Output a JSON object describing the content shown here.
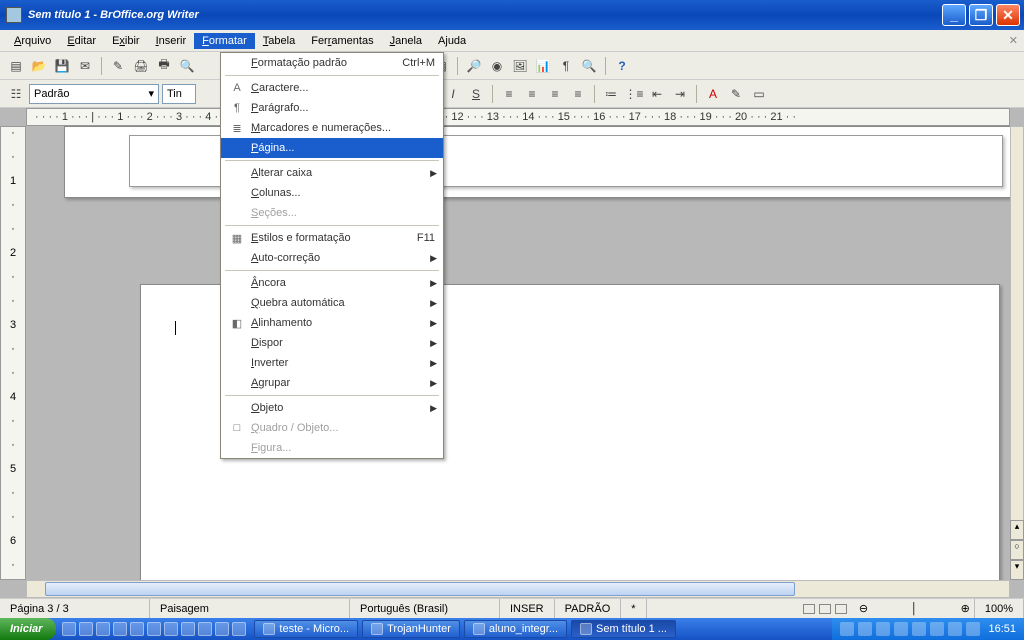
{
  "window": {
    "title": "Sem título 1 - BrOffice.org Writer"
  },
  "menubar": {
    "items": [
      "Arquivo",
      "Editar",
      "Exibir",
      "Inserir",
      "Formatar",
      "Tabela",
      "Ferramentas",
      "Janela",
      "Ajuda"
    ],
    "underline_index": [
      0,
      0,
      1,
      0,
      0,
      0,
      3,
      0,
      1
    ],
    "active_index": 4
  },
  "toolbar1": {
    "style_select": "Padrão",
    "font_select": "Tin"
  },
  "format_menu": {
    "items": [
      {
        "label": "Formatação padrão",
        "shortcut": "Ctrl+M",
        "icon": ""
      },
      {
        "sep": true
      },
      {
        "label": "Caractere...",
        "icon": "A"
      },
      {
        "label": "Parágrafo...",
        "icon": "¶"
      },
      {
        "label": "Marcadores e numerações...",
        "icon": "≣"
      },
      {
        "label": "Página...",
        "highlight": true
      },
      {
        "sep": true
      },
      {
        "label": "Alterar caixa",
        "submenu": true
      },
      {
        "label": "Colunas..."
      },
      {
        "label": "Seções...",
        "disabled": true
      },
      {
        "sep": true
      },
      {
        "label": "Estilos e formatação",
        "shortcut": "F11",
        "icon": "▦"
      },
      {
        "label": "Auto-correção",
        "submenu": true
      },
      {
        "sep": true
      },
      {
        "label": "Âncora",
        "submenu": true
      },
      {
        "label": "Quebra automática",
        "submenu": true
      },
      {
        "label": "Alinhamento",
        "submenu": true,
        "icon": "◧"
      },
      {
        "label": "Dispor",
        "submenu": true
      },
      {
        "label": "Inverter",
        "submenu": true
      },
      {
        "label": "Agrupar",
        "submenu": true
      },
      {
        "sep": true
      },
      {
        "label": "Objeto",
        "submenu": true
      },
      {
        "label": "Quadro / Objeto...",
        "disabled": true,
        "icon": "□"
      },
      {
        "label": "Figura...",
        "disabled": true
      }
    ]
  },
  "ruler_text": "· · · · 1 · · · | · · · 1 · · · 2 · · · 3 · · · 4 · · · 5 · · · 6 · · · 7 · · · 8 · · · 9 · · · 10 · · · 11 · · · 12 · · · 13 · · · 14 · · · 15 · · · 16 · · · 17 · · · 18 · · · 19 · · · 20 · · · 21 · ·",
  "vruler_text": [
    "·",
    "·",
    "1",
    "·",
    "·",
    "2",
    "·",
    "·",
    "3",
    "·",
    "·",
    "4",
    "·",
    "·",
    "5",
    "·",
    "·",
    "6",
    "·"
  ],
  "statusbar": {
    "page": "Página 3 / 3",
    "paper": "Paisagem",
    "lang": "Português (Brasil)",
    "insert": "INSER",
    "mode": "PADRÃO",
    "marker": "*",
    "zoom": "100%"
  },
  "taskbar": {
    "start": "Iniciar",
    "tasks": [
      {
        "label": "teste - Micro..."
      },
      {
        "label": "TrojanHunter"
      },
      {
        "label": "aluno_integr..."
      },
      {
        "label": "Sem título 1 ...",
        "active": true
      }
    ],
    "clock": "16:51"
  }
}
